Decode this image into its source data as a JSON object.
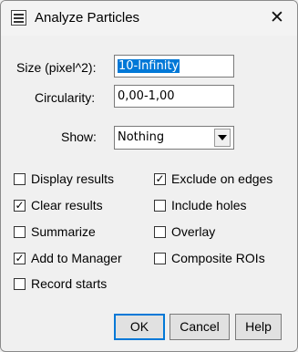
{
  "window": {
    "title": "Analyze Particles",
    "close_glyph": "✕",
    "icon": "imagej-icon"
  },
  "fields": {
    "size_label": "Size (pixel^2):",
    "size_value": "10-Infinity",
    "circularity_label": "Circularity:",
    "circularity_value": "0,00-1,00",
    "show_label": "Show:",
    "show_value": "Nothing"
  },
  "checkboxes": {
    "display_results": {
      "label": "Display results",
      "checked": false
    },
    "clear_results": {
      "label": "Clear results",
      "checked": true
    },
    "summarize": {
      "label": "Summarize",
      "checked": false
    },
    "add_to_manager": {
      "label": "Add to Manager",
      "checked": true
    },
    "record_starts": {
      "label": "Record starts",
      "checked": false
    },
    "exclude_on_edges": {
      "label": "Exclude on edges",
      "checked": true
    },
    "include_holes": {
      "label": "Include holes",
      "checked": false
    },
    "overlay": {
      "label": "Overlay",
      "checked": false
    },
    "composite_rois": {
      "label": "Composite ROIs",
      "checked": false
    }
  },
  "check_glyph": "✓",
  "buttons": {
    "ok": "OK",
    "cancel": "Cancel",
    "help": "Help"
  }
}
